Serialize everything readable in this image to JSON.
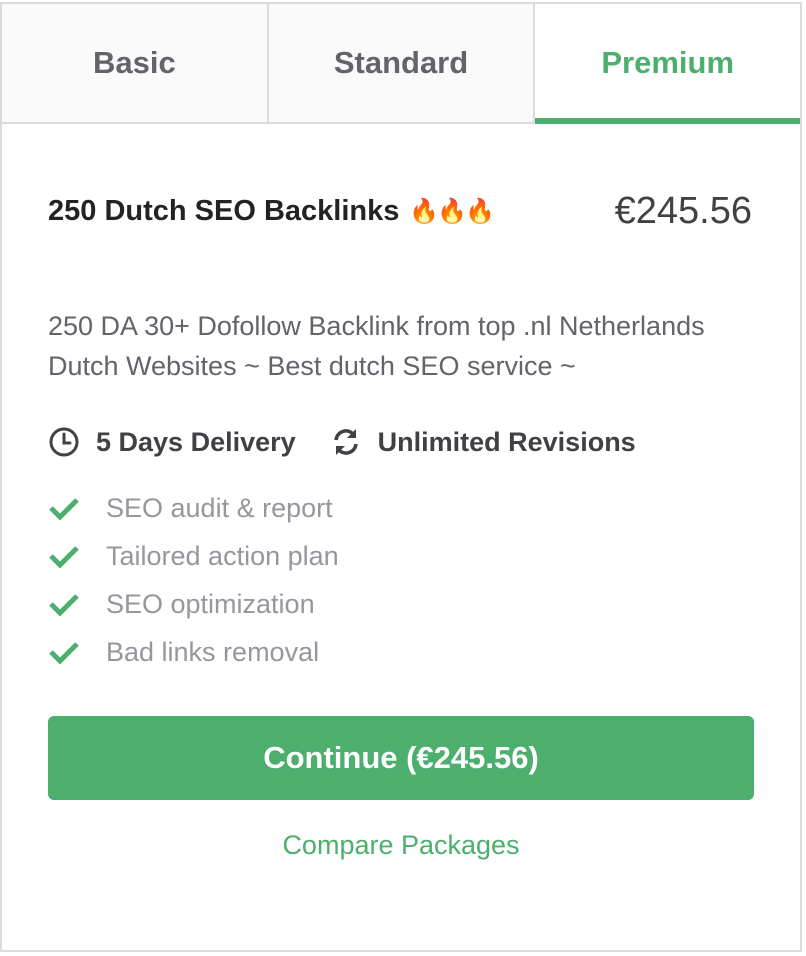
{
  "tabs": [
    {
      "label": "Basic"
    },
    {
      "label": "Standard"
    },
    {
      "label": "Premium"
    }
  ],
  "active_tab": "Premium",
  "package": {
    "title": "250 Dutch SEO Backlinks",
    "title_emoji": "🔥🔥🔥",
    "price": "€245.56",
    "description": "250 DA 30+ Dofollow Backlink from top .nl Netherlands Dutch Websites ~ Best dutch SEO service ~",
    "delivery": "5 Days Delivery",
    "revisions": "Unlimited Revisions",
    "features": [
      "SEO audit & report",
      "Tailored action plan",
      "SEO optimization",
      "Bad links removal"
    ]
  },
  "actions": {
    "continue_label": "Continue (€245.56)",
    "compare_label": "Compare Packages"
  },
  "colors": {
    "accent": "#4caf6d",
    "border": "#dadbdd"
  }
}
